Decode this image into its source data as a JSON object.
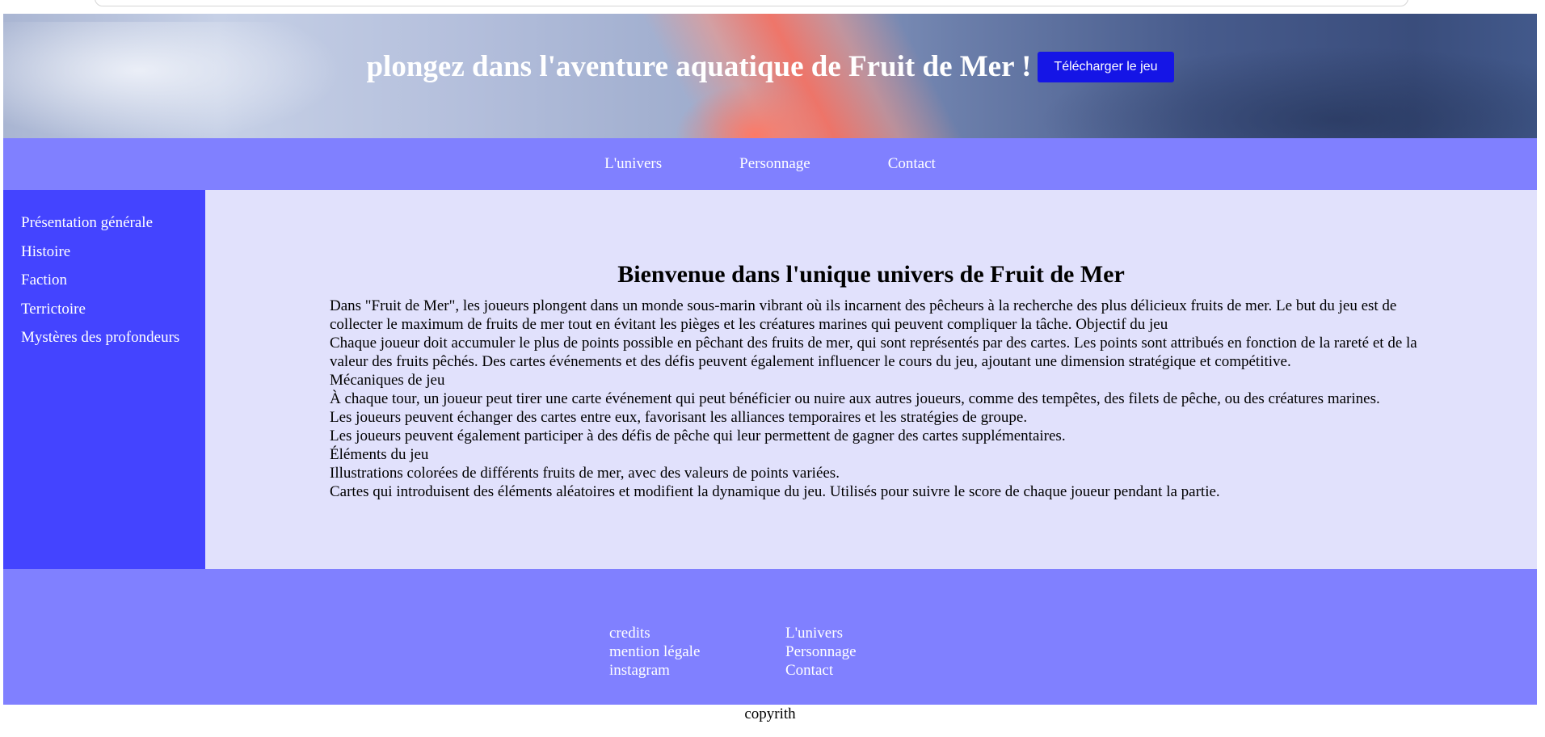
{
  "banner": {
    "title": "plongez dans l'aventure aquatique de Fruit de Mer !",
    "download_label": "Télécharger le jeu"
  },
  "topnav": {
    "items": [
      {
        "label": "L'univers"
      },
      {
        "label": "Personnage"
      },
      {
        "label": "Contact"
      }
    ]
  },
  "sidebar": {
    "items": [
      {
        "label": "Présentation générale"
      },
      {
        "label": "Histoire"
      },
      {
        "label": "Faction"
      },
      {
        "label": "Terrictoire"
      },
      {
        "label": "Mystères des profondeurs"
      }
    ]
  },
  "main": {
    "heading": "Bienvenue dans l'unique univers de Fruit de Mer",
    "paragraphs": [
      "Dans \"Fruit de Mer\", les joueurs plongent dans un monde sous-marin vibrant où ils incarnent des pêcheurs à la recherche des plus délicieux fruits de mer. Le but du jeu est de collecter le maximum de fruits de mer tout en évitant les pièges et les créatures marines qui peuvent compliquer la tâche. Objectif du jeu",
      "Chaque joueur doit accumuler le plus de points possible en pêchant des fruits de mer, qui sont représentés par des cartes. Les points sont attribués en fonction de la rareté et de la valeur des fruits pêchés. Des cartes événements et des défis peuvent également influencer le cours du jeu, ajoutant une dimension stratégique et compétitive.",
      "Mécaniques de jeu",
      "À chaque tour, un joueur peut tirer une carte événement qui peut bénéficier ou nuire aux autres joueurs, comme des tempêtes, des filets de pêche, ou des créatures marines.",
      "Les joueurs peuvent échanger des cartes entre eux, favorisant les alliances temporaires et les stratégies de groupe.",
      "Les joueurs peuvent également participer à des défis de pêche qui leur permettent de gagner des cartes supplémentaires.",
      "Éléments du jeu",
      "Illustrations colorées de différents fruits de mer, avec des valeurs de points variées.",
      "Cartes qui introduisent des éléments aléatoires et modifient la dynamique du jeu. Utilisés pour suivre le score de chaque joueur pendant la partie."
    ]
  },
  "footer": {
    "col1": [
      {
        "label": "credits"
      },
      {
        "label": "mention légale"
      },
      {
        "label": "instagram"
      }
    ],
    "col2": [
      {
        "label": "L'univers"
      },
      {
        "label": "Personnage"
      },
      {
        "label": "Contact"
      }
    ]
  },
  "copyright": "copyrith",
  "colors": {
    "download_button": "#1515e6",
    "nav_bg": "#8080ff",
    "sidebar_bg": "#4444ff",
    "main_bg": "#e1e1fc"
  }
}
